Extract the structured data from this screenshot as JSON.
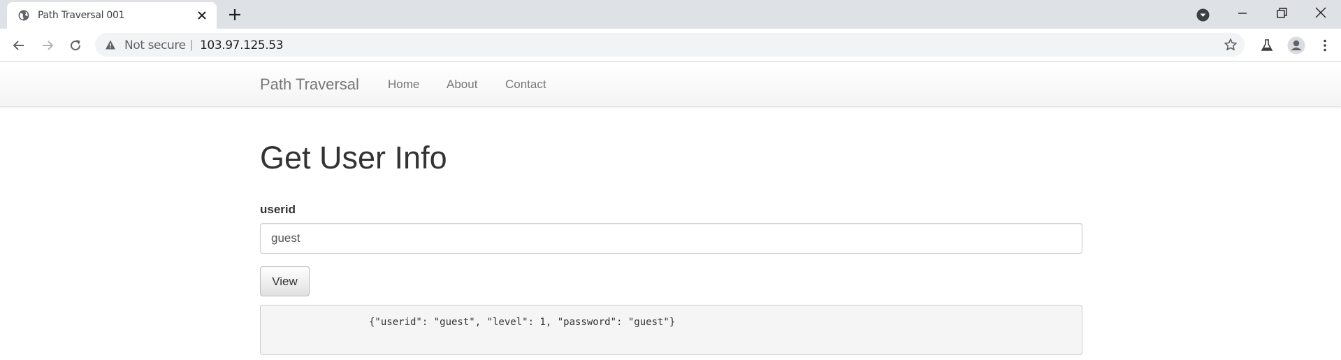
{
  "browser": {
    "tab": {
      "title": "Path Traversal 001"
    },
    "omnibox": {
      "security_label": "Not secure",
      "separator": "|",
      "url": "103.97.125.53"
    },
    "icons": [
      "globe-icon",
      "close-icon",
      "plus-icon",
      "tab-search-icon",
      "minimize-icon",
      "restore-icon",
      "window-close-icon",
      "back-arrow-icon",
      "forward-arrow-icon",
      "reload-icon",
      "warning-icon",
      "star-icon",
      "labs-flask-icon",
      "profile-icon",
      "kebab-menu-icon"
    ]
  },
  "navbar": {
    "brand": "Path Traversal",
    "links": [
      {
        "label": "Home"
      },
      {
        "label": "About"
      },
      {
        "label": "Contact"
      }
    ]
  },
  "main": {
    "title": "Get User Info",
    "field_label": "userid",
    "userid_value": "guest",
    "view_button": "View",
    "result": "{\"userid\": \"guest\", \"level\": 1, \"password\": \"guest\"}"
  }
}
